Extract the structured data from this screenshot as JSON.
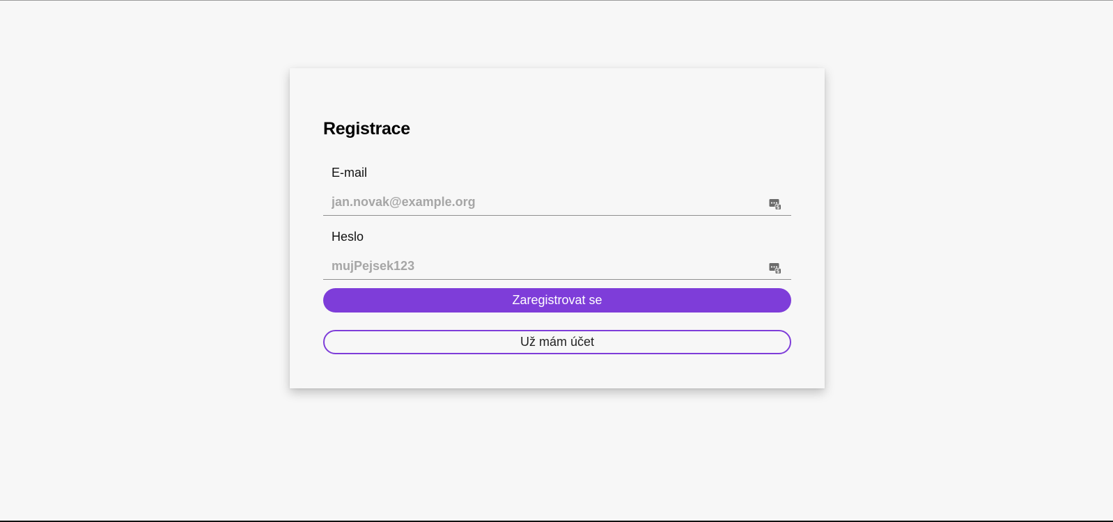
{
  "form": {
    "title": "Registrace",
    "email": {
      "label": "E-mail",
      "placeholder": "jan.novak@example.org",
      "value": "",
      "icon": "password-manager-icon"
    },
    "password": {
      "label": "Heslo",
      "placeholder": "mujPejsek123",
      "value": "",
      "icon": "password-manager-icon"
    },
    "register_button": "Zaregistrovat se",
    "have_account_button": "Už mám účet"
  },
  "colors": {
    "accent": "#7e3dd9",
    "background": "#f7f7f7",
    "button_text": "#ffffff"
  }
}
